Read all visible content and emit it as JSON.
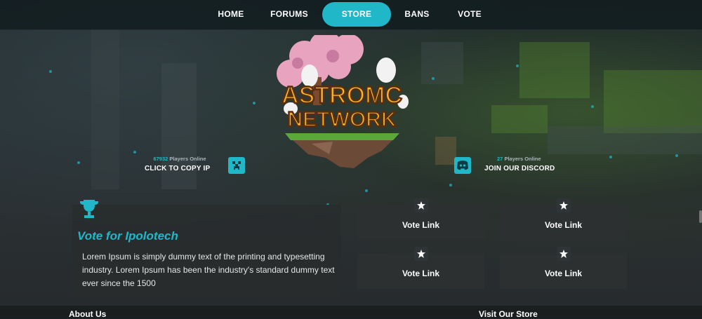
{
  "nav": {
    "items": [
      {
        "label": "HOME"
      },
      {
        "label": "FORUMS"
      },
      {
        "label": "STORE",
        "active": true
      },
      {
        "label": "BANS"
      },
      {
        "label": "VOTE"
      }
    ]
  },
  "logo": {
    "text_line1": "ASTROMC",
    "text_line2": "NETWORK"
  },
  "server_ip": {
    "players_count": "67932",
    "players_label": "Players Online",
    "action": "CLICK TO COPY IP",
    "icon": "creeper-icon"
  },
  "discord": {
    "players_count": "27",
    "players_label": "Players Online",
    "action": "JOIN OUR DISCORD",
    "icon": "discord-icon"
  },
  "vote": {
    "title": "Vote for Ipolotech",
    "text": "Lorem Ipsum is simply dummy text of the printing and typesetting industry. Lorem Ipsum has been the industry's standard dummy text ever since the 1500",
    "links": [
      {
        "label": "Vote Link"
      },
      {
        "label": "Vote Link"
      },
      {
        "label": "Vote Link"
      },
      {
        "label": "Vote Link"
      }
    ]
  },
  "footer": {
    "about": "About Us",
    "store": "Visit Our Store"
  },
  "colors": {
    "accent": "#20b8c8",
    "card": "#2c3032",
    "nav": "#121c20"
  }
}
